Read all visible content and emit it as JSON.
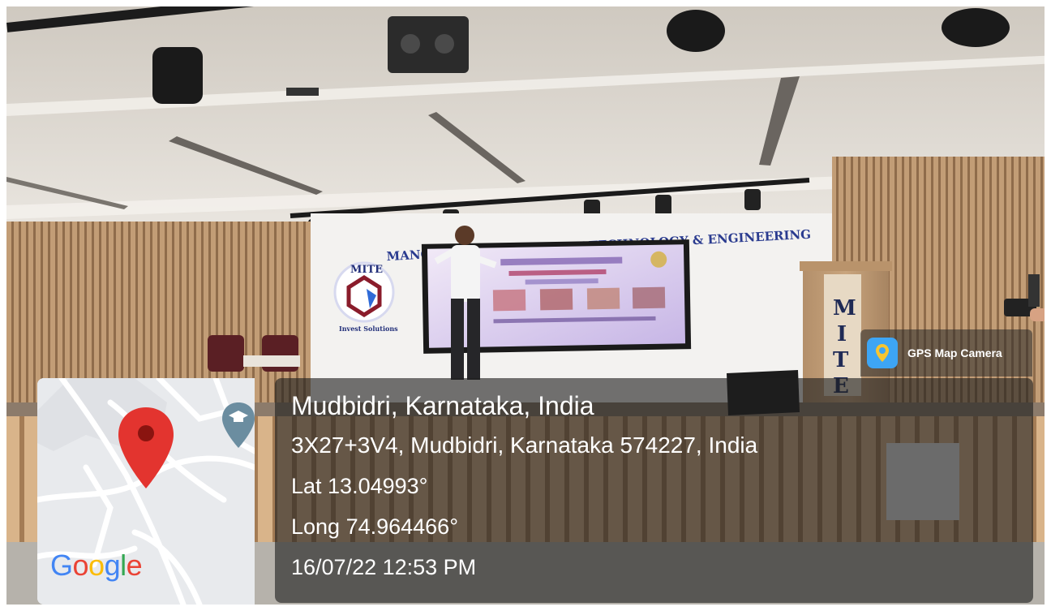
{
  "stage": {
    "banner_text": "MANGALORE INSTITUTE OF TECHNOLOGY & ENGINEERING",
    "logo_top": "MITE",
    "logo_bottom": "Invest Solutions",
    "lectern_letters": [
      "M",
      "I",
      "T",
      "E"
    ]
  },
  "gps_badge": {
    "label": "GPS Map Camera",
    "icon": "gps-map-camera-app-icon"
  },
  "location": {
    "place": "Mudbidri, Karnataka, India",
    "address": "3X27+3V4, Mudbidri, Karnataka 574227, India",
    "latitude": "Lat 13.04993°",
    "longitude": "Long 74.964466°",
    "timestamp": "16/07/22 12:53 PM"
  },
  "map": {
    "provider_logo": "Google",
    "pin_icon": "map-pin-icon",
    "poi_icon": "graduation-cap-pin-icon",
    "colors": {
      "pin": "#e3342f",
      "poi": "#6b8da0",
      "google_blue": "#4285F4",
      "google_red": "#EA4335",
      "google_yellow": "#FBBC05",
      "google_green": "#34A853"
    }
  }
}
